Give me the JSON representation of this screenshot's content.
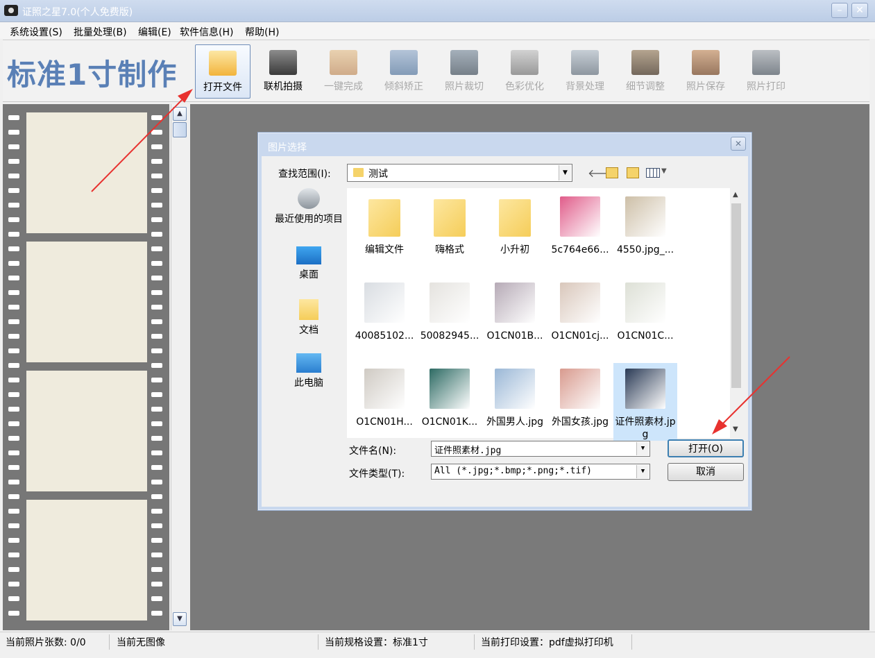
{
  "window": {
    "title": "证照之星7.0(个人免费版)"
  },
  "menu": [
    "系统设置(S)",
    "批量处理(B)",
    "编辑(E)",
    "软件信息(H)",
    "帮助(H)"
  ],
  "toolbar": {
    "brand": "标准1寸制作",
    "tools": [
      {
        "label": "打开文件",
        "icon": "folder-open-icon",
        "state": "active"
      },
      {
        "label": "联机拍摄",
        "icon": "camera-icon",
        "state": "enabled"
      },
      {
        "label": "一键完成",
        "icon": "hand-pointer-icon",
        "state": "disabled"
      },
      {
        "label": "倾斜矫正",
        "icon": "rotate-icon",
        "state": "disabled"
      },
      {
        "label": "照片裁切",
        "icon": "crop-icon",
        "state": "disabled"
      },
      {
        "label": "色彩优化",
        "icon": "color-sliders-icon",
        "state": "disabled"
      },
      {
        "label": "背景处理",
        "icon": "brush-icon",
        "state": "disabled"
      },
      {
        "label": "细节调整",
        "icon": "histogram-icon",
        "state": "disabled"
      },
      {
        "label": "照片保存",
        "icon": "floppy-disk-icon",
        "state": "disabled"
      },
      {
        "label": "照片打印",
        "icon": "printer-icon",
        "state": "disabled"
      }
    ]
  },
  "dialog": {
    "title": "图片选择",
    "look_in_label": "查找范围(I):",
    "look_in_value": "测试",
    "places": [
      {
        "label": "最近使用的项目",
        "icon": "recent-items-icon"
      },
      {
        "label": "桌面",
        "icon": "desktop-icon"
      },
      {
        "label": "文档",
        "icon": "documents-icon"
      },
      {
        "label": "此电脑",
        "icon": "computer-icon"
      }
    ],
    "files": [
      {
        "name": "编辑文件",
        "kind": "folder"
      },
      {
        "name": "嗨格式",
        "kind": "folder"
      },
      {
        "name": "小升初",
        "kind": "folder"
      },
      {
        "name": "5c764e66...",
        "kind": "image",
        "color": "#e05c8a"
      },
      {
        "name": "4550.jpg_...",
        "kind": "image",
        "color": "#cdbfa7"
      },
      {
        "name": "40085102...",
        "kind": "image",
        "color": "#d9dde2"
      },
      {
        "name": "50082945...",
        "kind": "image",
        "color": "#e5e3df"
      },
      {
        "name": "O1CN01B...",
        "kind": "image",
        "color": "#b6aab6"
      },
      {
        "name": "O1CN01cj...",
        "kind": "image",
        "color": "#d9c7bb"
      },
      {
        "name": "O1CN01C...",
        "kind": "image",
        "color": "#dde0d6"
      },
      {
        "name": "O1CN01H...",
        "kind": "image",
        "color": "#cfcac3"
      },
      {
        "name": "O1CN01K...",
        "kind": "image",
        "color": "#2d6a63"
      },
      {
        "name": "外国男人.jpg",
        "kind": "image",
        "color": "#9ab7d6"
      },
      {
        "name": "外国女孩.jpg",
        "kind": "image",
        "color": "#d89a8e"
      },
      {
        "name": "证件照素材.jpg",
        "kind": "image",
        "color": "#2a3a55",
        "selected": true
      }
    ],
    "filename_label": "文件名(N):",
    "filename_value": "证件照素材.jpg",
    "filetype_label": "文件类型(T):",
    "filetype_value": "All (*.jpg;*.bmp;*.png;*.tif)",
    "open_button": "打开(O)",
    "cancel_button": "取消"
  },
  "status": {
    "count": "当前照片张数: 0/0",
    "image": "当前无图像",
    "spec": "当前规格设置：标准1寸",
    "print": "当前打印设置：pdf虚拟打印机"
  },
  "colors": {
    "accent": "#5a80b6",
    "workspace": "#7a7a7a",
    "annotation_arrow": "#e8322f"
  }
}
